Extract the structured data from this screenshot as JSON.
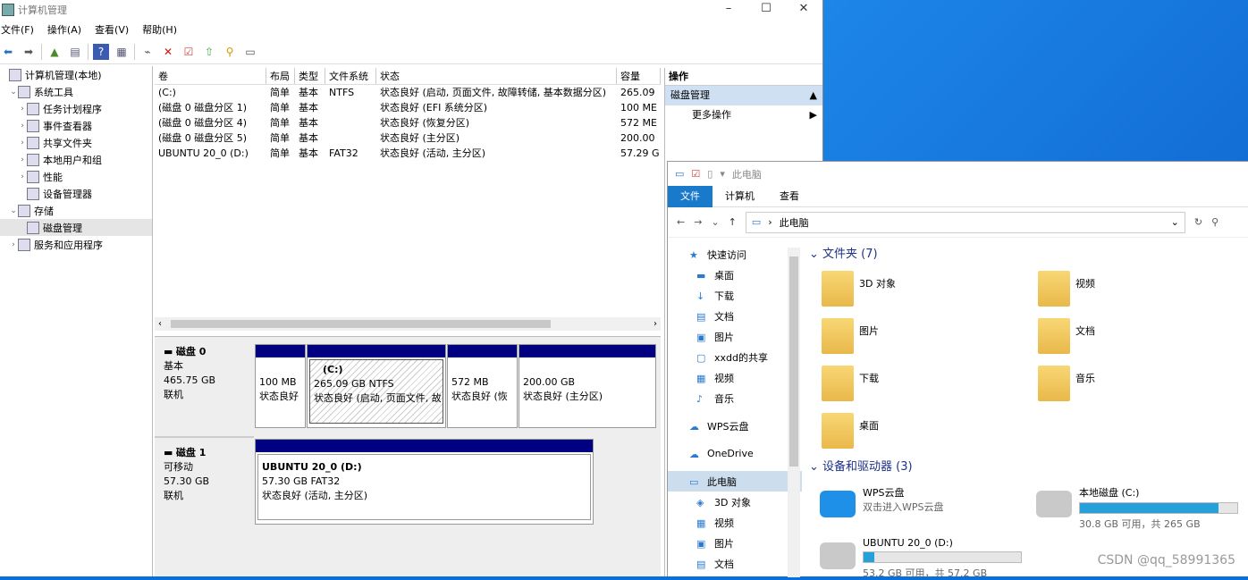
{
  "cm": {
    "title": "计算机管理",
    "menu": [
      "文件(F)",
      "操作(A)",
      "查看(V)",
      "帮助(H)"
    ],
    "tree": [
      {
        "label": "计算机管理(本地)",
        "arrow": "",
        "indent": 0
      },
      {
        "label": "系统工具",
        "arrow": "⌄",
        "indent": 1
      },
      {
        "label": "任务计划程序",
        "arrow": "›",
        "indent": 2
      },
      {
        "label": "事件查看器",
        "arrow": "›",
        "indent": 2
      },
      {
        "label": "共享文件夹",
        "arrow": "›",
        "indent": 2
      },
      {
        "label": "本地用户和组",
        "arrow": "›",
        "indent": 2
      },
      {
        "label": "性能",
        "arrow": "›",
        "indent": 2
      },
      {
        "label": "设备管理器",
        "arrow": "",
        "indent": 2
      },
      {
        "label": "存储",
        "arrow": "⌄",
        "indent": 1
      },
      {
        "label": "磁盘管理",
        "arrow": "",
        "indent": 2
      },
      {
        "label": "服务和应用程序",
        "arrow": "›",
        "indent": 1
      }
    ],
    "columns": [
      "卷",
      "布局",
      "类型",
      "文件系统",
      "状态",
      "容量"
    ],
    "volumes": [
      [
        "(C:)",
        "简单",
        "基本",
        "NTFS",
        "状态良好 (启动, 页面文件, 故障转储, 基本数据分区)",
        "265.09"
      ],
      [
        "(磁盘 0 磁盘分区 1)",
        "简单",
        "基本",
        "",
        "状态良好 (EFI 系统分区)",
        "100 ME"
      ],
      [
        "(磁盘 0 磁盘分区 4)",
        "简单",
        "基本",
        "",
        "状态良好 (恢复分区)",
        "572 ME"
      ],
      [
        "(磁盘 0 磁盘分区 5)",
        "简单",
        "基本",
        "",
        "状态良好 (主分区)",
        "200.00"
      ],
      [
        "UBUNTU 20_0 (D:)",
        "简单",
        "基本",
        "FAT32",
        "状态良好 (活动, 主分区)",
        "57.29 G"
      ]
    ],
    "disk0": {
      "name": "磁盘 0",
      "type": "基本",
      "size": "465.75 GB",
      "status": "联机"
    },
    "disk0parts": [
      {
        "l1": "",
        "l2": "100 MB",
        "l3": "状态良好"
      },
      {
        "l1": "(C:)",
        "l2": "265.09 GB NTFS",
        "l3": "状态良好 (启动, 页面文件, 故"
      },
      {
        "l1": "",
        "l2": "572 MB",
        "l3": "状态良好 (恢"
      },
      {
        "l1": "",
        "l2": "200.00 GB",
        "l3": "状态良好 (主分区)"
      }
    ],
    "disk1": {
      "name": "磁盘 1",
      "type": "可移动",
      "size": "57.30 GB",
      "status": "联机"
    },
    "disk1part": {
      "l1": "UBUNTU 20_0  (D:)",
      "l2": "57.30 GB FAT32",
      "l3": "状态良好 (活动, 主分区)"
    },
    "actions": {
      "header": "操作",
      "section": "磁盘管理",
      "more": "更多操作"
    }
  },
  "ex": {
    "title": "此电脑",
    "tabs": [
      "文件",
      "计算机",
      "查看"
    ],
    "addr": "此电脑",
    "nav": [
      {
        "label": "快速访问",
        "icon": "★",
        "pin": false
      },
      {
        "label": "桌面",
        "icon": "▬",
        "pin": true
      },
      {
        "label": "下载",
        "icon": "↓",
        "pin": true
      },
      {
        "label": "文档",
        "icon": "▤",
        "pin": true
      },
      {
        "label": "图片",
        "icon": "▣",
        "pin": true
      },
      {
        "label": "xxdd的共享",
        "icon": "▢",
        "pin": false
      },
      {
        "label": "视频",
        "icon": "▦",
        "pin": false
      },
      {
        "label": "音乐",
        "icon": "♪",
        "pin": false
      },
      {
        "label": "",
        "icon": "",
        "pin": false
      },
      {
        "label": "WPS云盘",
        "icon": "☁",
        "pin": false
      },
      {
        "label": "",
        "icon": "",
        "pin": false
      },
      {
        "label": "OneDrive",
        "icon": "☁",
        "pin": false
      },
      {
        "label": "",
        "icon": "",
        "pin": false
      },
      {
        "label": "此电脑",
        "icon": "▭",
        "pin": false
      },
      {
        "label": "3D 对象",
        "icon": "◈",
        "pin": false
      },
      {
        "label": "视频",
        "icon": "▦",
        "pin": false
      },
      {
        "label": "图片",
        "icon": "▣",
        "pin": false
      },
      {
        "label": "文档",
        "icon": "▤",
        "pin": false
      }
    ],
    "folders_header": "文件夹 (7)",
    "folders": [
      "3D 对象",
      "视频",
      "图片",
      "文档",
      "下载",
      "音乐",
      "桌面"
    ],
    "drives_header": "设备和驱动器 (3)",
    "drives": [
      {
        "name": "WPS云盘",
        "sub": "双击进入WPS云盘",
        "bar": false,
        "fill": 0
      },
      {
        "name": "本地磁盘 (C:)",
        "sub": "30.8 GB 可用，共 265 GB",
        "bar": true,
        "fill": 0.88
      },
      {
        "name": "UBUNTU 20_0 (D:)",
        "sub": "53.2 GB 可用，共 57.2 GB",
        "bar": true,
        "fill": 0.07
      }
    ]
  },
  "watermark": "CSDN @qq_58991365",
  "colors": {
    "partition_bar": "#000080",
    "accent": "#1979ca",
    "drive_bar": "#26a0da"
  }
}
